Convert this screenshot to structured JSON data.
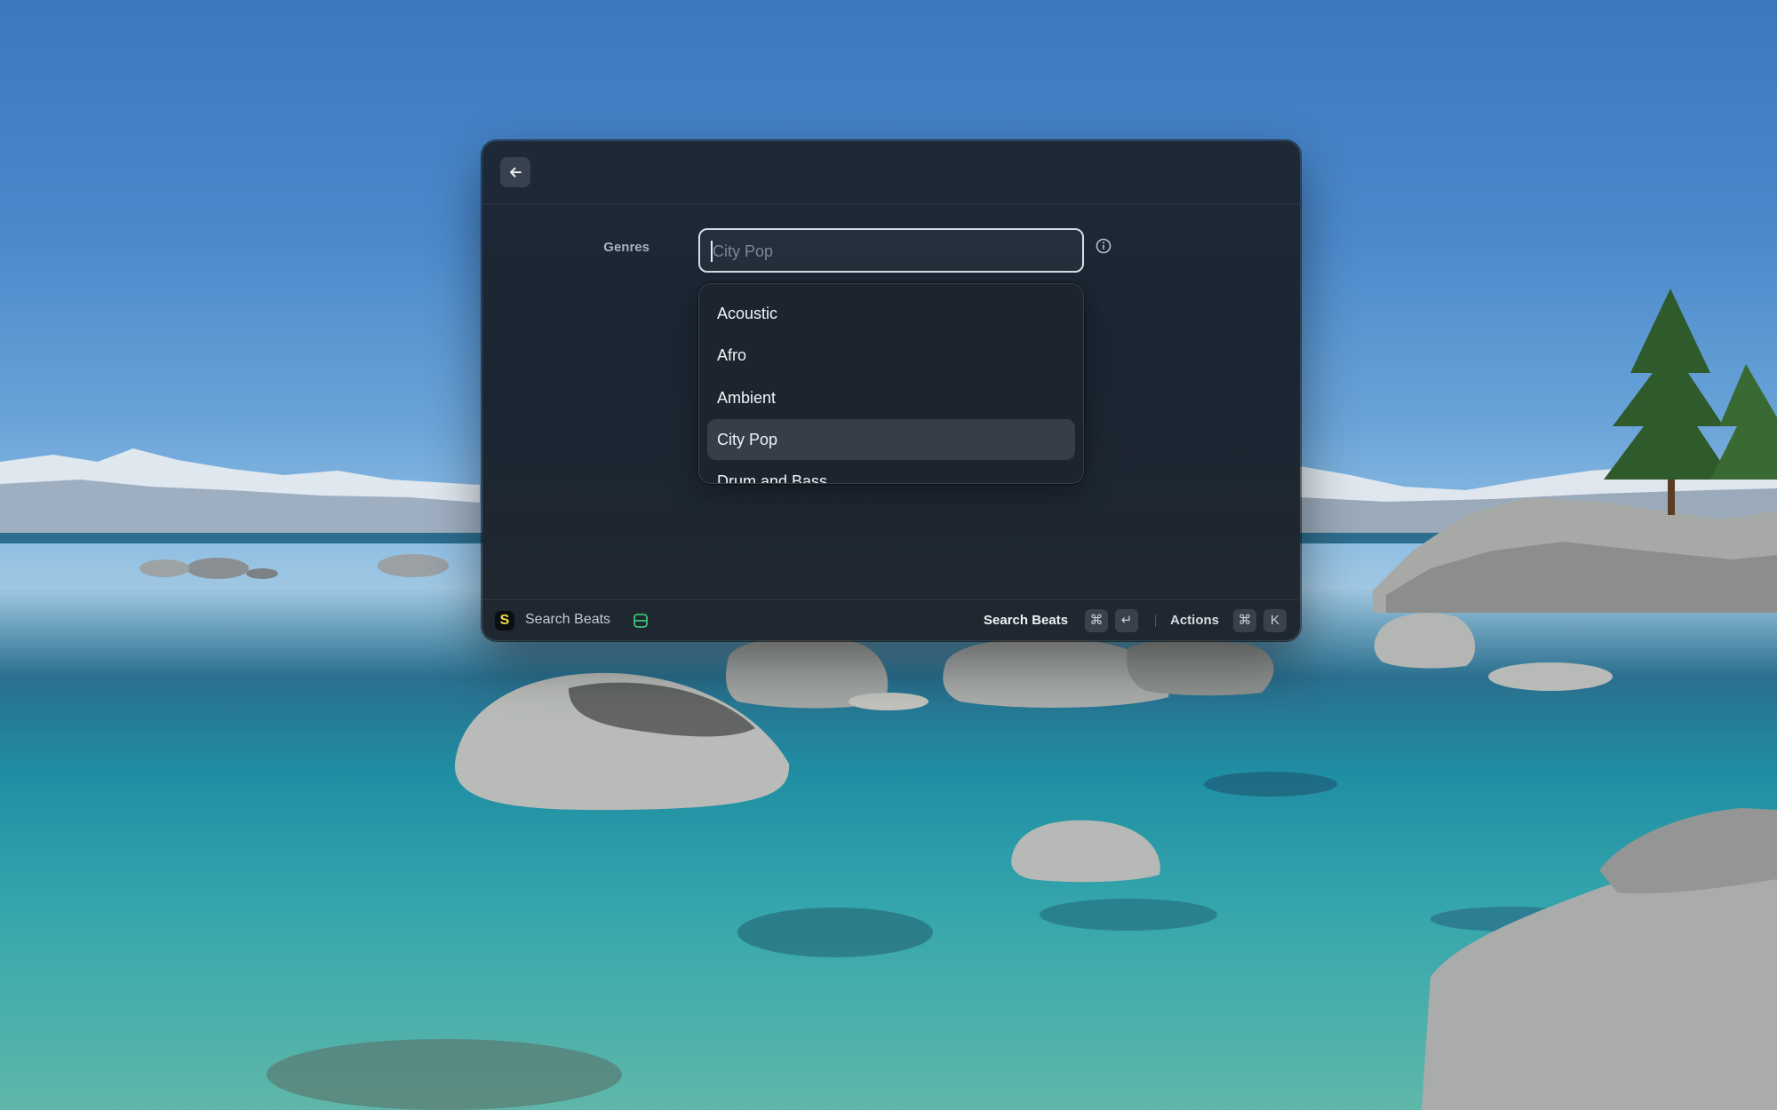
{
  "window": {
    "back_icon": "arrow-left-icon"
  },
  "form": {
    "genres_label": "Genres",
    "genres_placeholder": "City Pop",
    "genres_value": "",
    "info_icon": "info-icon"
  },
  "dropdown": {
    "options": [
      {
        "label": "Acoustic"
      },
      {
        "label": "Afro"
      },
      {
        "label": "Ambient"
      },
      {
        "label": "City Pop"
      },
      {
        "label": "Drum and Bass"
      }
    ],
    "selected": "City Pop"
  },
  "footer": {
    "app_logo_letter": "S",
    "app_title": "Search Beats",
    "primary_action_label": "Search Beats",
    "primary_action_keys": [
      "⌘",
      "↵"
    ],
    "secondary_action_label": "Actions",
    "secondary_action_keys": [
      "⌘",
      "K"
    ]
  },
  "colors": {
    "accent_green": "#3ec27a",
    "logo_yellow": "#f0dd4a"
  }
}
